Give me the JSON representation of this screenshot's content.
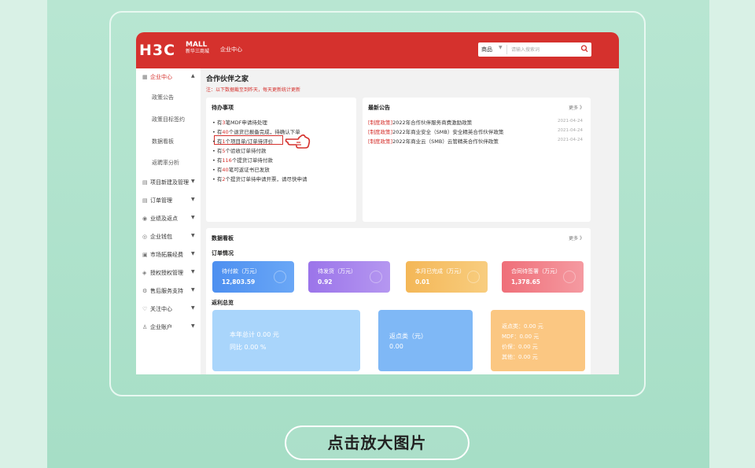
{
  "header": {
    "logo_text": "H3C",
    "logo_mall": "MALL",
    "logo_sub": "新华三商城",
    "portal_label": "企业中心",
    "search_category": "商品",
    "search_placeholder": "请输入搜索词"
  },
  "sidebar": {
    "items": [
      {
        "label": "企业中心",
        "icon": "grid-icon",
        "active": true,
        "expanded": true
      },
      {
        "label": "项目新建及管理",
        "icon": "file-icon"
      },
      {
        "label": "订单管理",
        "icon": "list-icon"
      },
      {
        "label": "业绩及返点",
        "icon": "chart-icon"
      },
      {
        "label": "企业钱包",
        "icon": "wallet-icon"
      },
      {
        "label": "市场拓展经费",
        "icon": "bag-icon"
      },
      {
        "label": "授权授权管理",
        "icon": "shield-icon"
      },
      {
        "label": "售后服务支持",
        "icon": "wrench-icon"
      },
      {
        "label": "关注中心",
        "icon": "heart-icon"
      },
      {
        "label": "企业账户",
        "icon": "user-icon"
      }
    ],
    "sub_items": [
      "政策公告",
      "政策目标签约",
      "数据看板",
      "返聘率分析"
    ]
  },
  "main": {
    "title": "合作伙伴之家",
    "note": "注：以下数据截至到昨天，每天更新统计更新",
    "todo": {
      "title": "待办事项",
      "items": [
        {
          "pre": "有",
          "num": "3",
          "post": "笔MDF申请待处理"
        },
        {
          "pre": "有",
          "num": "40",
          "post": "个退货已报备完成，待确认下单"
        },
        {
          "pre": "有",
          "num": "1",
          "post": "个项目单/订单待评价"
        },
        {
          "pre": "有",
          "num": "5",
          "post": "个验收订单待付款"
        },
        {
          "pre": "有",
          "num": "116",
          "post": "个提货订单待付款"
        },
        {
          "pre": "有",
          "num": "40",
          "post": "笔可返证书已发放"
        },
        {
          "pre": "有",
          "num": "2",
          "post": "个提货订单待申请开票，请尽快申请"
        }
      ]
    },
    "announcements": {
      "title": "最新公告",
      "more": "更多 》",
      "items": [
        {
          "tag": "[制度政策]",
          "text": "2022年合作伙伴服务商费激励政策",
          "date": "2021-04-24"
        },
        {
          "tag": "[制度政策]",
          "text": "2022年商业安全（SMB）安全精英合作伙伴政策",
          "date": "2021-04-24"
        },
        {
          "tag": "[制度政策]",
          "text": "2022年商业云（SMB）云管精英合作伙伴政策",
          "date": "2021-04-24"
        }
      ]
    },
    "dashboard": {
      "title": "数据看板",
      "more": "更多 》",
      "orders_title": "订单情况",
      "stats": [
        {
          "label": "待付款（万元）",
          "value": "12,803.59",
          "color": "#4d8ff0"
        },
        {
          "label": "待发货（万元）",
          "value": "0.92",
          "color": "#9b74ea"
        },
        {
          "label": "本月已完成（万元）",
          "value": "0.01",
          "color": "#f4b757"
        },
        {
          "label": "合同待签署（万元）",
          "value": "1,378.65",
          "color": "#ef6f79"
        }
      ],
      "rebate_title": "返利总览",
      "annual_label": "本年总计 0.00 元",
      "yoy_label": "同比 0.00 %",
      "points_label": "返点类（元）",
      "points_value": "0.00",
      "breakdown": [
        "返点类：0.00 元",
        "MDF：0.00 元",
        "价保：0.00 元",
        "其他：0.00 元"
      ]
    }
  },
  "zoom_button": "点击放大图片",
  "colors": {
    "brand": "#d5312d",
    "background": "#a6dec6"
  }
}
